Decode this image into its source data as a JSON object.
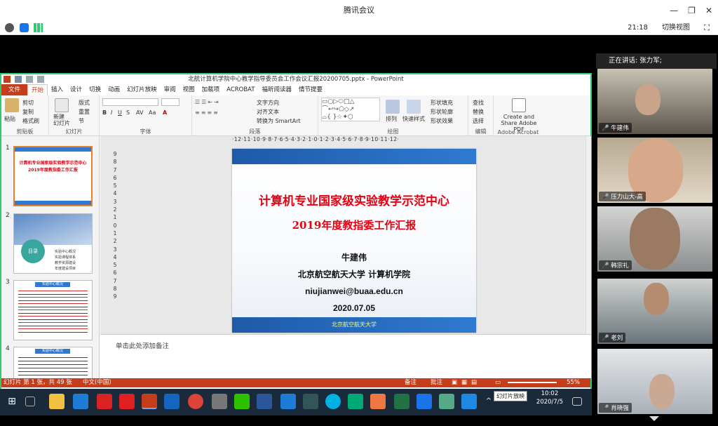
{
  "meeting": {
    "app_title": "腾讯会议",
    "time": "21:18",
    "switch_view": "切换视图",
    "speaking_label": "正在讲话: 张力军;",
    "participants": [
      "牛建伟",
      "压力山大-高",
      "韩宗礼",
      "老刘",
      "肖晓强"
    ]
  },
  "ppt": {
    "window_title": "北航计算机学院中心教学指导委员会工作会议汇报20200705.pptx - PowerPoint",
    "tabs": [
      "文件",
      "开始",
      "插入",
      "设计",
      "切换",
      "动画",
      "幻灯片放映",
      "审阅",
      "视图",
      "加载项",
      "ACROBAT",
      "福昕阅读器",
      "情节提要"
    ],
    "groups": {
      "clipboard": {
        "label": "剪贴板",
        "paste": "粘贴",
        "cut": "剪切",
        "copy": "复制",
        "painter": "格式刷"
      },
      "slides": {
        "label": "幻灯片",
        "new": "新建\n幻灯片",
        "layout": "版式",
        "reset": "重置",
        "section": "节"
      },
      "font": {
        "label": "字体"
      },
      "paragraph": {
        "label": "段落",
        "text_dir": "文字方向",
        "align": "对齐文本",
        "smartart": "转换为 SmartArt"
      },
      "drawing": {
        "label": "绘图",
        "arrange": "排列",
        "quick_styles": "快速样式",
        "fill": "形状填充",
        "outline": "形状轮廓",
        "effects": "形状效果"
      },
      "editing": {
        "label": "编辑",
        "find": "查找",
        "replace": "替换",
        "select": "选择"
      },
      "acrobat": {
        "label": "Adobe Acrobat",
        "create": "Create and Share Adobe PDF"
      }
    },
    "ruler_h": "·12·11·10·9·8·7·6·5·4·3·2·1·0·1·2·3·4·5·6·7·8·9·10·11·12·",
    "ruler_v": [
      "9",
      "8",
      "7",
      "6",
      "5",
      "4",
      "3",
      "2",
      "1",
      "0",
      "1",
      "2",
      "3",
      "4",
      "5",
      "6",
      "7",
      "8",
      "9"
    ],
    "slide": {
      "title1": "计算机专业国家级实验教学示范中心",
      "title2": "2019年度教指委工作汇报",
      "name": "牛建伟",
      "org": "北京航空航天大学 计算机学院",
      "email": "niujianwei@buaa.edu.cn",
      "date": "2020.07.05",
      "footer": "北京航空航天大学"
    },
    "thumbs": {
      "t1_title": "计算机专业国家级实验教学示范中心 2019年度教指委工作汇报",
      "t2_label": "目录",
      "t2_items": [
        "实验中心概况",
        "实验课程体系",
        "教学资源建设",
        "年度建设项目"
      ],
      "t3_title": "实验中心概况",
      "t4_title": "实验中心概况"
    },
    "slide_numbers": [
      "1",
      "2",
      "3",
      "4"
    ],
    "notes_placeholder": "单击此处添加备注",
    "status": {
      "slide_info": "幻灯片 第 1 张，共 49 张",
      "lang": "中文(中国)",
      "notes": "备注",
      "comments": "批注",
      "zoom": "55%"
    }
  },
  "taskbar": {
    "time": "10:02",
    "date": "2020/7/5",
    "tooltip": "幻灯片放映"
  }
}
